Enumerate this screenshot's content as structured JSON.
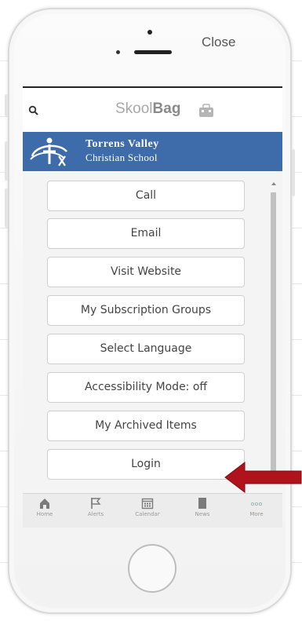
{
  "top_bar": {
    "close_label": "Close"
  },
  "app": {
    "brand_light": "Skool",
    "brand_bold": "Bag",
    "school_name_line1": "Torrens Valley",
    "school_name_line2": "Christian School"
  },
  "menu": {
    "items": [
      {
        "label": "Call"
      },
      {
        "label": "Email"
      },
      {
        "label": "Visit Website"
      },
      {
        "label": "My Subscription Groups"
      },
      {
        "label": "Select Language"
      },
      {
        "label": "Accessibility Mode: off"
      },
      {
        "label": "My Archived Items"
      },
      {
        "label": "Login"
      }
    ]
  },
  "tabs": [
    {
      "label": "Home",
      "icon": "home-icon"
    },
    {
      "label": "Alerts",
      "icon": "flag-icon"
    },
    {
      "label": "Calendar",
      "icon": "calendar-icon"
    },
    {
      "label": "News",
      "icon": "news-icon"
    },
    {
      "label": "More",
      "icon": "more-icon"
    }
  ],
  "colors": {
    "banner": "#3e6cab",
    "arrow": "#b0131b",
    "tab_bar": "#ececec"
  }
}
